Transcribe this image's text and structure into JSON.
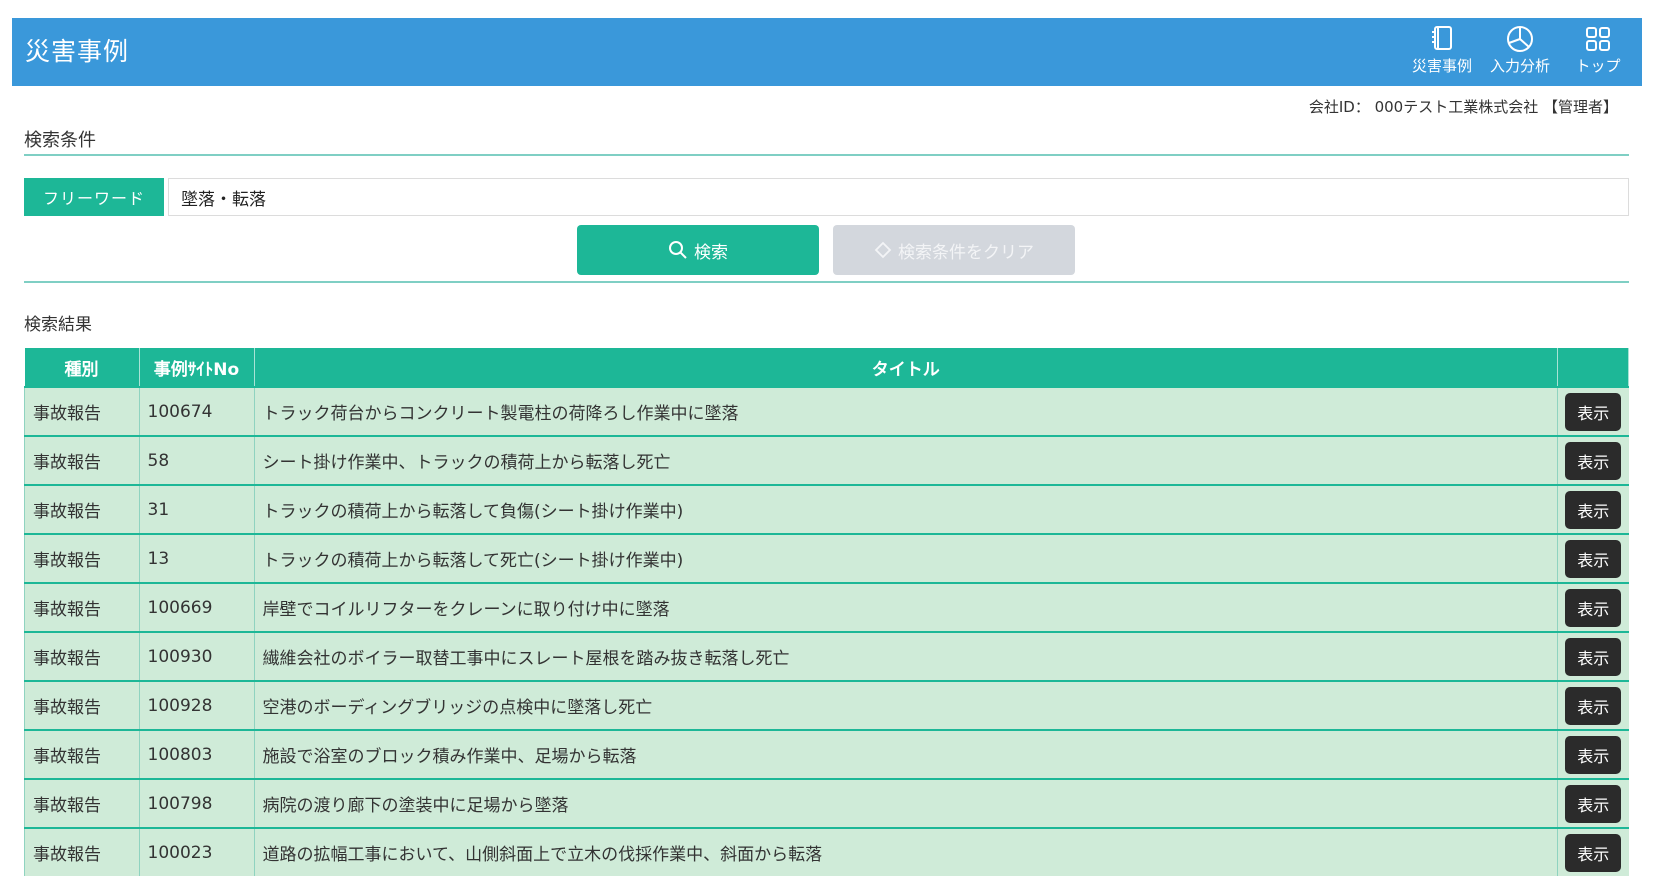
{
  "header": {
    "title": "災害事例",
    "nav": [
      {
        "label": "災害事例",
        "icon": "notebook-icon"
      },
      {
        "label": "入力分析",
        "icon": "pie-chart-icon"
      },
      {
        "label": "トップ",
        "icon": "grid-icon"
      }
    ]
  },
  "company_info": "会社ID： 000テスト工業株式会社 【管理者】",
  "search": {
    "section_title": "検索条件",
    "freeword_label": "フリーワード",
    "freeword_value": "墜落・転落",
    "search_button": "検索",
    "clear_button": "検索条件をクリア"
  },
  "results": {
    "section_title": "検索結果",
    "columns": [
      "種別",
      "事例ｻｲﾄNo",
      "タイトル",
      ""
    ],
    "rows": [
      {
        "type": "事故報告",
        "no": "100674",
        "title": "トラック荷台からコンクリート製電柱の荷降ろし作業中に墜落",
        "action": "表示"
      },
      {
        "type": "事故報告",
        "no": "58",
        "title": "シート掛け作業中、トラックの積荷上から転落し死亡",
        "action": "表示"
      },
      {
        "type": "事故報告",
        "no": "31",
        "title": "トラックの積荷上から転落して負傷(シート掛け作業中)",
        "action": "表示"
      },
      {
        "type": "事故報告",
        "no": "13",
        "title": "トラックの積荷上から転落して死亡(シート掛け作業中)",
        "action": "表示"
      },
      {
        "type": "事故報告",
        "no": "100669",
        "title": "岸壁でコイルリフターをクレーンに取り付け中に墜落",
        "action": "表示"
      },
      {
        "type": "事故報告",
        "no": "100930",
        "title": "繊維会社のボイラー取替工事中にスレート屋根を踏み抜き転落し死亡",
        "action": "表示"
      },
      {
        "type": "事故報告",
        "no": "100928",
        "title": "空港のボーディングブリッジの点検中に墜落し死亡",
        "action": "表示"
      },
      {
        "type": "事故報告",
        "no": "100803",
        "title": "施設で浴室のブロック積み作業中、足場から転落",
        "action": "表示"
      },
      {
        "type": "事故報告",
        "no": "100798",
        "title": "病院の渡り廊下の塗装中に足場から墜落",
        "action": "表示"
      },
      {
        "type": "事故報告",
        "no": "100023",
        "title": "道路の拡幅工事において、山側斜面上で立木の伐採作業中、斜面から転落",
        "action": "表示"
      }
    ]
  }
}
